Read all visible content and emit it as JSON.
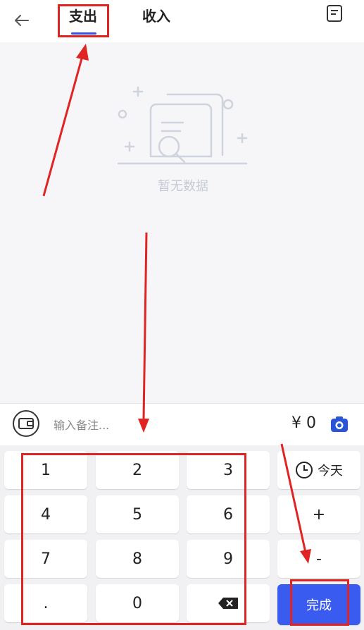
{
  "header": {
    "tabs": [
      {
        "label": "支出",
        "active": true
      },
      {
        "label": "收入",
        "active": false
      }
    ],
    "icons": {
      "back": "arrow-left-icon",
      "bill": "document-icon"
    }
  },
  "empty_state": {
    "text": "暂无数据",
    "icon": "empty-document-search-icon"
  },
  "note_bar": {
    "placeholder": "输入备注...",
    "amount": "¥ 0",
    "icons": {
      "account": "wallet-icon",
      "camera": "camera-icon"
    }
  },
  "keypad": {
    "keys": [
      "1",
      "2",
      "3",
      "4",
      "5",
      "6",
      "7",
      "8",
      "9",
      ".",
      "0"
    ],
    "backspace_icon": "backspace-icon",
    "date_label": "今天",
    "date_icon": "clock-icon",
    "plus": "+",
    "minus": "-",
    "done": "完成"
  },
  "colors": {
    "accent": "#3a5bf0",
    "annotation": "#e02424"
  }
}
